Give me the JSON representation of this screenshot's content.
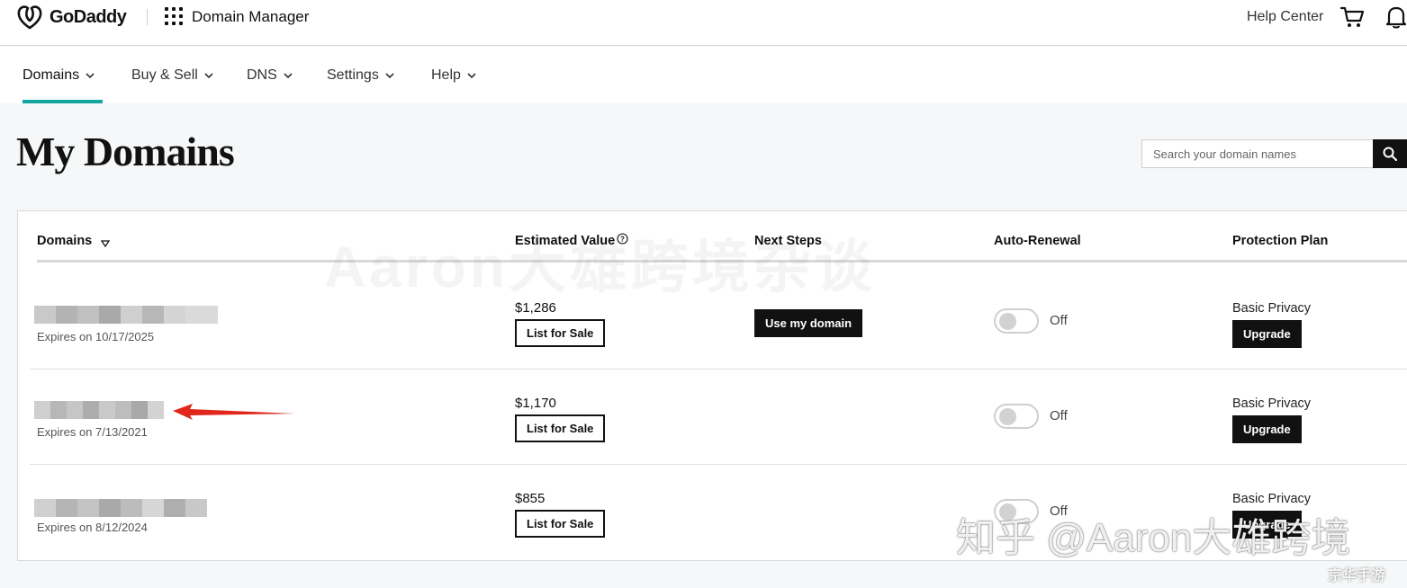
{
  "header": {
    "logo_text": "GoDaddy",
    "app_title": "Domain Manager",
    "help_center": "Help Center",
    "icons": [
      "godaddy-logo-icon",
      "apps-grid-icon",
      "cart-icon",
      "bell-icon"
    ]
  },
  "nav": {
    "items": [
      {
        "label": "Domains",
        "active": true
      },
      {
        "label": "Buy & Sell"
      },
      {
        "label": "DNS"
      },
      {
        "label": "Settings"
      },
      {
        "label": "Help"
      }
    ],
    "accent_color": "#12a6a0"
  },
  "page": {
    "title": "My Domains",
    "search_placeholder": "Search your domain names"
  },
  "table": {
    "columns": [
      "Domains",
      "Estimated Value",
      "Next Steps",
      "Auto-Renewal",
      "Protection Plan"
    ],
    "rows": [
      {
        "expires": "Expires on 10/17/2025",
        "value": "$1,286",
        "list_label": "List for Sale",
        "next_step": "Use my domain",
        "auto_renewal": "Off",
        "plan": "Basic Privacy",
        "upgrade_label": "Upgrade"
      },
      {
        "expires": "Expires on 7/13/2021",
        "value": "$1,170",
        "list_label": "List for Sale",
        "next_step": "",
        "auto_renewal": "Off",
        "plan": "Basic Privacy",
        "upgrade_label": "Upgrade"
      },
      {
        "expires": "Expires on 8/12/2024",
        "value": "$855",
        "list_label": "List for Sale",
        "next_step": "",
        "auto_renewal": "Off",
        "plan": "Basic Privacy",
        "upgrade_label": "Upgrade"
      }
    ]
  },
  "overlays": {
    "watermark": "Aaron大雄跨境杂谈",
    "zhihu_watermark": "知乎 @Aaron大雄跨境",
    "corner_badge": "京华手游"
  }
}
